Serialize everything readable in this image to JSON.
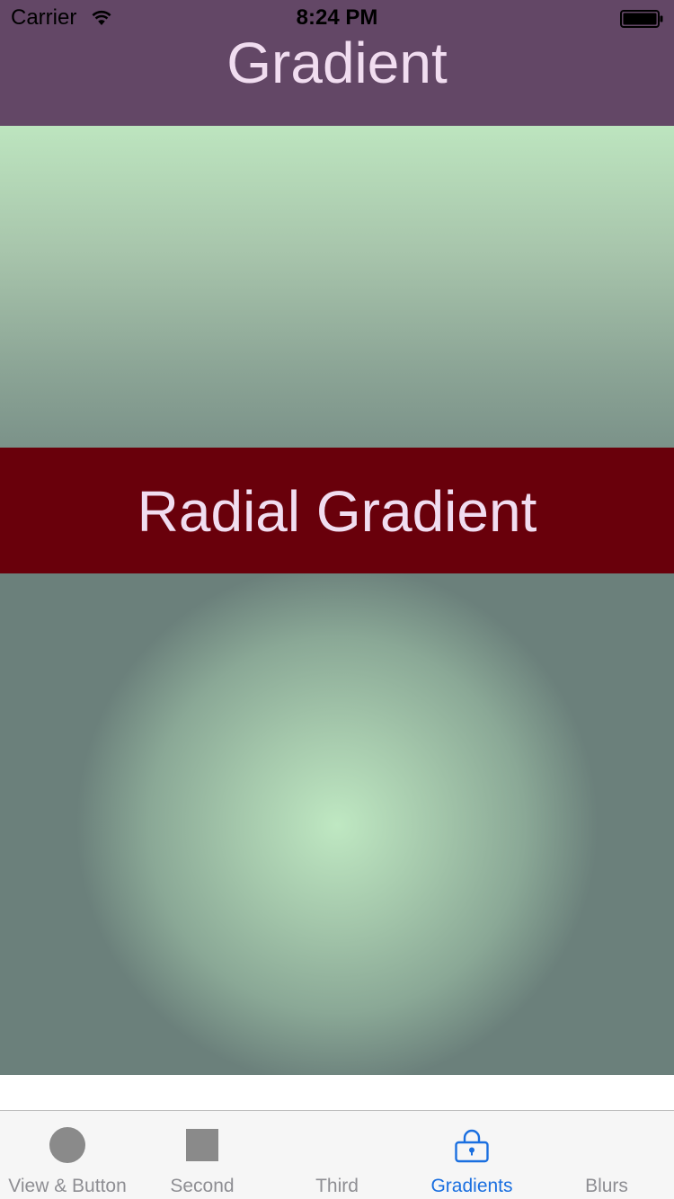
{
  "status_bar": {
    "carrier": "Carrier",
    "time": "8:24 PM",
    "wifi_icon": "wifi-icon",
    "battery_icon": "battery-icon"
  },
  "nav": {
    "title": "Gradient"
  },
  "sections": {
    "radial_title": "Radial Gradient"
  },
  "tab_bar": {
    "items": [
      {
        "label": "View & Button",
        "icon": "circle-icon",
        "active": false
      },
      {
        "label": "Second",
        "icon": "square-icon",
        "active": false
      },
      {
        "label": "Third",
        "icon": "",
        "active": false
      },
      {
        "label": "Gradients",
        "icon": "lock-icon",
        "active": true
      },
      {
        "label": "Blurs",
        "icon": "",
        "active": false
      }
    ]
  },
  "colors": {
    "nav_background": "#634766",
    "title_text": "#f1ddf0",
    "banner_background": "#69000b",
    "gradient_light": "#bde5bf",
    "gradient_dark": "#6b807b",
    "tab_active": "#1a6fe0",
    "tab_inactive": "#8e8e93"
  }
}
